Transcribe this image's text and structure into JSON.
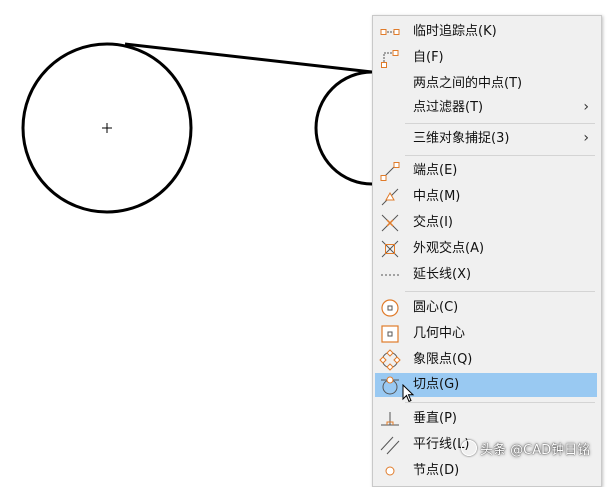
{
  "menu": {
    "items": [
      {
        "label": "临时追踪点(K)",
        "icon": "temporary-track-point-icon"
      },
      {
        "label": "自(F)",
        "icon": "from-icon"
      },
      {
        "label": "两点之间的中点(T)",
        "icon": ""
      },
      {
        "label": "点过滤器(T)",
        "icon": "",
        "submenu": "›"
      },
      {
        "label": "三维对象捕捉(3)",
        "icon": "",
        "submenu": "›"
      },
      {
        "label": "端点(E)",
        "icon": "endpoint-icon"
      },
      {
        "label": "中点(M)",
        "icon": "midpoint-icon"
      },
      {
        "label": "交点(I)",
        "icon": "intersection-icon"
      },
      {
        "label": "外观交点(A)",
        "icon": "apparent-intersection-icon"
      },
      {
        "label": "延长线(X)",
        "icon": "extension-icon"
      },
      {
        "label": "圆心(C)",
        "icon": "center-icon"
      },
      {
        "label": "几何中心",
        "icon": "geometric-center-icon"
      },
      {
        "label": "象限点(Q)",
        "icon": "quadrant-icon"
      },
      {
        "label": "切点(G)",
        "icon": "tangent-icon",
        "highlighted": true
      },
      {
        "label": "垂直(P)",
        "icon": "perpendicular-icon"
      },
      {
        "label": "平行线(L)",
        "icon": "parallel-icon"
      },
      {
        "label": "节点(D)",
        "icon": "node-icon"
      }
    ]
  },
  "watermark": {
    "text": "头条 @CAD钟日铭"
  },
  "colors": {
    "highlight": "#99c9f2",
    "icon_accent": "#e07b2a",
    "menu_bg": "#f0f0f0"
  }
}
